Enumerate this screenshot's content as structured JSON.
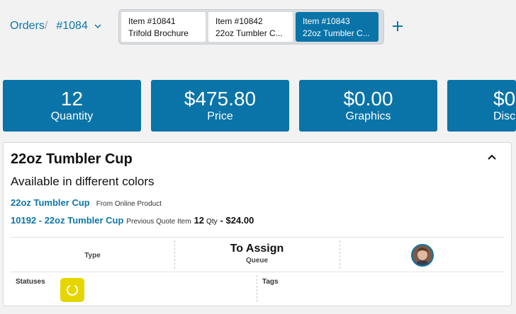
{
  "breadcrumb": {
    "orders": "Orders",
    "separator": "/",
    "order_number": "#1084"
  },
  "tabs": [
    {
      "item": "Item #10841",
      "name": "Trifold Brochure",
      "active": false
    },
    {
      "item": "Item #10842",
      "name": "22oz Tumbler C...",
      "active": false
    },
    {
      "item": "Item #10843",
      "name": "22oz Tumbler C...",
      "active": true
    }
  ],
  "stats": [
    {
      "value": "12",
      "label": "Quantity"
    },
    {
      "value": "$475.80",
      "label": "Price"
    },
    {
      "value": "$0.00",
      "label": "Graphics"
    },
    {
      "value": "$0.",
      "label": "Disc"
    }
  ],
  "item": {
    "title": "22oz Tumbler Cup",
    "subtitle": "Available in different colors",
    "product_link": "22oz Tumbler Cup",
    "product_source": "From Online Product",
    "quote_link": "10192 - 22oz Tumbler Cup",
    "quote_source": "Previous Quote Item",
    "quote_qty": "12",
    "quote_qty_unit": "Qty",
    "quote_price": "- $24.00"
  },
  "details": {
    "type_label": "Type",
    "queue_value": "To Assign",
    "queue_label": "Queue",
    "statuses_label": "Statuses",
    "tags_label": "Tags"
  },
  "colors": {
    "accent": "#0a74a8",
    "status": "#e6d600"
  }
}
